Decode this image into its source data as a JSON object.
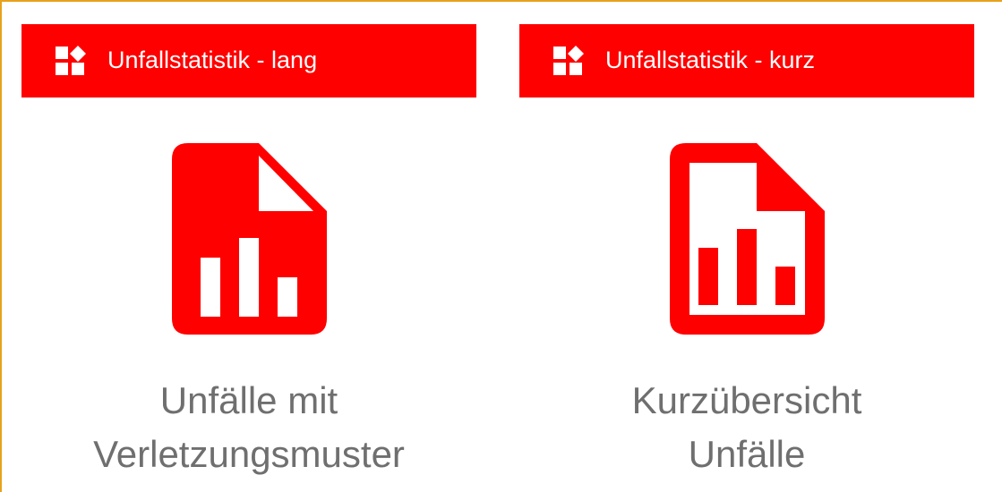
{
  "tiles": [
    {
      "header": "Unfallstatistik - lang",
      "header_icon": "widgets-icon",
      "doc_icon": "document-chart-filled-icon",
      "caption_line1": "Unfälle mit",
      "caption_line2": "Verletzungsmuster"
    },
    {
      "header": "Unfallstatistik - kurz",
      "header_icon": "widgets-icon",
      "doc_icon": "document-chart-outline-icon",
      "caption_line1": "Kurzübersicht",
      "caption_line2": "Unfälle"
    }
  ],
  "colors": {
    "accent": "#ff0000",
    "caption_text": "#6f6f6f",
    "frame_border": "#e8a21b"
  }
}
